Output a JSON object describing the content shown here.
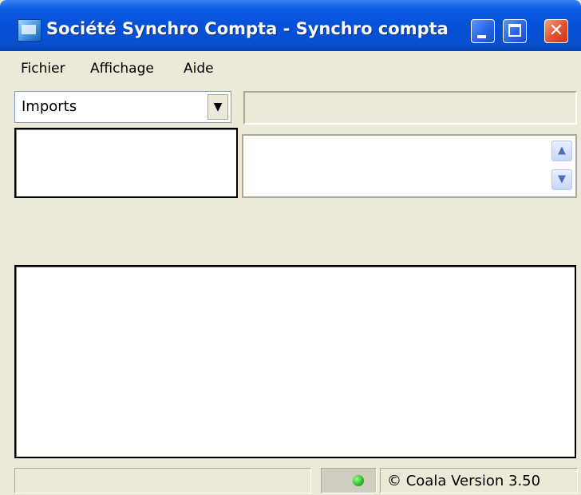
{
  "window": {
    "title": "Société Synchro Compta - Synchro compta",
    "icon": "app-icon",
    "controls": {
      "minimize_icon": "minimize-icon",
      "maximize_icon": "maximize-icon",
      "close_glyph": "✕"
    },
    "titlebar_color": "#0551d8",
    "close_color": "#e2502b"
  },
  "menu": {
    "items": [
      {
        "label": "Fichier"
      },
      {
        "label": "Affichage"
      },
      {
        "label": "Aide"
      }
    ]
  },
  "toolbar": {
    "combo_value": "Imports",
    "combo_arrow": "▼"
  },
  "panels": {
    "scroll_up": "▲",
    "scroll_down": "▼"
  },
  "status_bar": {
    "left_text": "",
    "indicator_color": "#2cc02c",
    "version_text": "© Coala Version 3.50"
  }
}
